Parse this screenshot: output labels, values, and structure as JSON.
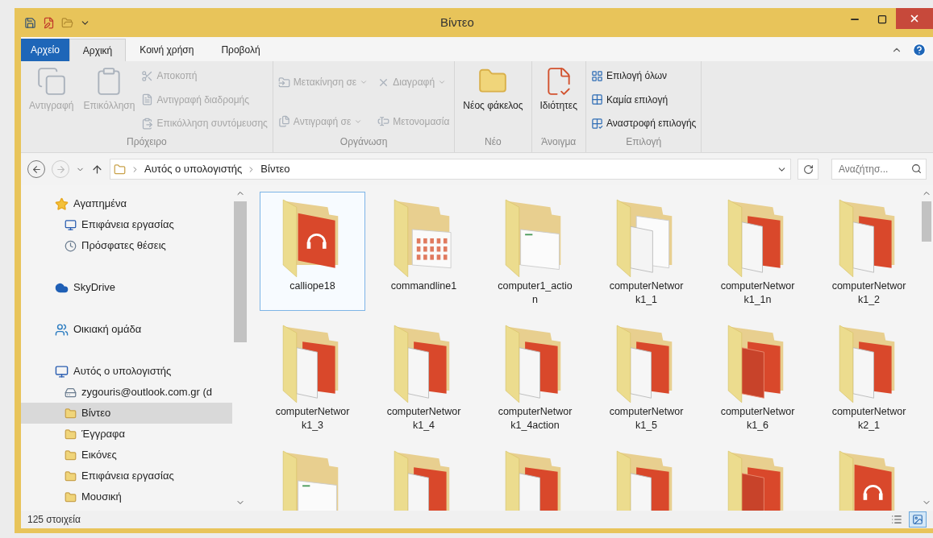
{
  "window": {
    "title": "Βίντεο"
  },
  "tabs": [
    {
      "label": "Αρχείο",
      "kind": "file",
      "selected": false
    },
    {
      "label": "Αρχική",
      "kind": "tab",
      "selected": true
    },
    {
      "label": "Κοινή χρήση",
      "kind": "tab",
      "selected": false
    },
    {
      "label": "Προβολή",
      "kind": "tab",
      "selected": false
    }
  ],
  "ribbon": {
    "groups": [
      {
        "label": "Πρόχειρο",
        "disabled": true,
        "large": [
          {
            "label": "Αντιγραφή"
          },
          {
            "label": "Επικόλληση"
          }
        ],
        "small": [
          {
            "label": "Αποκοπή",
            "dropdown": false
          },
          {
            "label": "Αντιγραφή διαδρομής",
            "dropdown": false
          },
          {
            "label": "Επικόλληση συντόμευσης",
            "dropdown": false
          }
        ]
      },
      {
        "label": "Οργάνωση",
        "disabled": true,
        "small": [
          {
            "label": "Μετακίνηση σε",
            "dropdown": true
          },
          {
            "label": "Αντιγραφή σε",
            "dropdown": true
          },
          {
            "label": "Διαγραφή",
            "dropdown": true
          },
          {
            "label": "Μετονομασία",
            "dropdown": false
          }
        ]
      },
      {
        "label": "Νέο",
        "disabled": false,
        "large": [
          {
            "label": "Νέος φάκελος"
          }
        ]
      },
      {
        "label": "Άνοιγμα",
        "disabled": false,
        "large": [
          {
            "label": "Ιδιότητες"
          }
        ]
      },
      {
        "label": "Επιλογή",
        "disabled": false,
        "small": [
          {
            "label": "Επιλογή όλων",
            "dropdown": false
          },
          {
            "label": "Καμία επιλογή",
            "dropdown": false
          },
          {
            "label": "Αναστροφή επιλογής",
            "dropdown": false
          }
        ]
      }
    ]
  },
  "address": {
    "path": [
      "Αυτός ο υπολογιστής",
      "Βίντεο"
    ],
    "search_placeholder": "Αναζήτησ..."
  },
  "sidebar": {
    "items": [
      {
        "label": "Αγαπημένα",
        "selected": false,
        "children": [
          {
            "label": "Επιφάνεια εργασίας",
            "selected": false
          },
          {
            "label": "Πρόσφατες θέσεις",
            "selected": false
          }
        ]
      },
      {
        "label": "SkyDrive",
        "selected": false
      },
      {
        "label": "Οικιακή ομάδα",
        "selected": false
      },
      {
        "label": "Αυτός ο υπολογιστής",
        "selected": false,
        "children": [
          {
            "label": "zygouris@outlook.com.gr (d",
            "selected": false
          },
          {
            "label": "Βίντεο",
            "selected": true
          },
          {
            "label": "Έγγραφα",
            "selected": false
          },
          {
            "label": "Εικόνες",
            "selected": false
          },
          {
            "label": "Επιφάνεια εργασίας",
            "selected": false
          },
          {
            "label": "Μουσική",
            "selected": false
          }
        ]
      }
    ]
  },
  "files": [
    {
      "name": "calliope18",
      "kind": "audio",
      "selected": true
    },
    {
      "name": "commandline1",
      "kind": "screens",
      "selected": false
    },
    {
      "name": "computer1_action",
      "kind": "page",
      "selected": false
    },
    {
      "name": "computerNetwork1_1",
      "kind": "pages",
      "selected": false
    },
    {
      "name": "computerNetwork1_1n",
      "kind": "mixed",
      "selected": false
    },
    {
      "name": "computerNetwork1_2",
      "kind": "mixed",
      "selected": false
    },
    {
      "name": "computerNetwork1_3",
      "kind": "mixed",
      "selected": false
    },
    {
      "name": "computerNetwork1_4",
      "kind": "mixed",
      "selected": false
    },
    {
      "name": "computerNetwork1_4action",
      "kind": "mixed",
      "selected": false
    },
    {
      "name": "computerNetwork1_5",
      "kind": "mixed",
      "selected": false
    },
    {
      "name": "computerNetwork1_6",
      "kind": "red",
      "selected": false
    },
    {
      "name": "computerNetwork2_1",
      "kind": "mixed",
      "selected": false
    },
    {
      "kind": "page",
      "selected": false
    },
    {
      "kind": "mixed",
      "selected": false
    },
    {
      "kind": "mixed",
      "selected": false
    },
    {
      "kind": "mixed",
      "selected": false
    },
    {
      "kind": "red",
      "selected": false
    },
    {
      "kind": "audio",
      "selected": false
    }
  ],
  "status_bar": {
    "count": "125 στοιχεία",
    "views": [
      {
        "kind": "details",
        "selected": false
      },
      {
        "kind": "large",
        "selected": true
      }
    ]
  }
}
